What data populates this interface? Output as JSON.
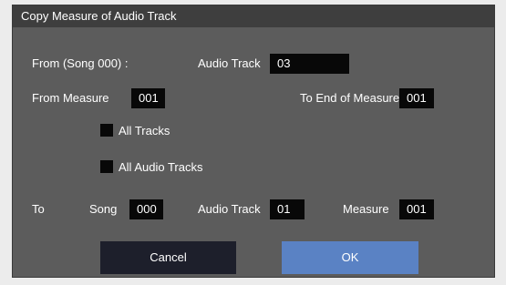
{
  "dialog": {
    "title": "Copy Measure of Audio Track",
    "from_label": "From (Song 000) :",
    "from_audio_track_label": "Audio Track",
    "from_audio_track_value": "03",
    "from_measure_label": "From Measure",
    "from_measure_value": "001",
    "to_end_label": "To End of Measure",
    "to_end_value": "001",
    "all_tracks_label": "All Tracks",
    "all_audio_tracks_label": "All Audio Tracks",
    "to_label": "To",
    "to_song_label": "Song",
    "to_song_value": "000",
    "to_audio_track_label": "Audio Track",
    "to_audio_track_value": "01",
    "to_measure_label": "Measure",
    "to_measure_value": "001",
    "cancel_label": "Cancel",
    "ok_label": "OK"
  }
}
